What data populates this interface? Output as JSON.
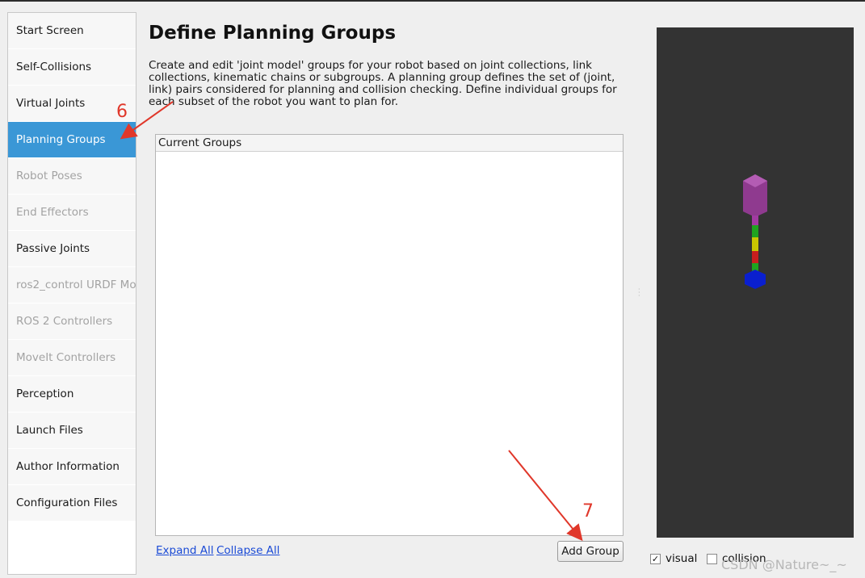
{
  "sidebar": {
    "items": [
      {
        "label": "Start Screen",
        "state": "normal"
      },
      {
        "label": "Self-Collisions",
        "state": "normal"
      },
      {
        "label": "Virtual Joints",
        "state": "normal"
      },
      {
        "label": "Planning Groups",
        "state": "active"
      },
      {
        "label": "Robot Poses",
        "state": "disabled"
      },
      {
        "label": "End Effectors",
        "state": "disabled"
      },
      {
        "label": "Passive Joints",
        "state": "normal"
      },
      {
        "label": "ros2_control URDF Mod",
        "state": "disabled"
      },
      {
        "label": "ROS 2 Controllers",
        "state": "disabled"
      },
      {
        "label": "MoveIt Controllers",
        "state": "disabled"
      },
      {
        "label": "Perception",
        "state": "normal"
      },
      {
        "label": "Launch Files",
        "state": "normal"
      },
      {
        "label": "Author Information",
        "state": "normal"
      },
      {
        "label": "Configuration Files",
        "state": "normal"
      }
    ]
  },
  "main": {
    "title": "Define Planning Groups",
    "description": "Create and edit 'joint model' groups for your robot based on joint collections, link collections, kinematic chains or subgroups. A planning group defines the set of (joint, link) pairs considered for planning and collision checking. Define individual groups for each subset of the robot you want to plan for.",
    "groups_header": "Current Groups",
    "expand_all": "Expand All",
    "collapse_all": "Collapse All",
    "add_group": "Add Group"
  },
  "viewer": {
    "visual_label": "visual",
    "visual_checked": true,
    "collision_label": "collision",
    "collision_checked": false,
    "robot_colors": [
      "#9a3e9a",
      "#1fa31f",
      "#c9c600",
      "#c81e1e",
      "#0a1fcf"
    ]
  },
  "annotations": [
    "6",
    "7"
  ],
  "colors": {
    "accent": "#3a97d6",
    "annotation": "#e0372a",
    "link": "#1b4bd6"
  },
  "watermark": "CSDN @Nature~_~"
}
